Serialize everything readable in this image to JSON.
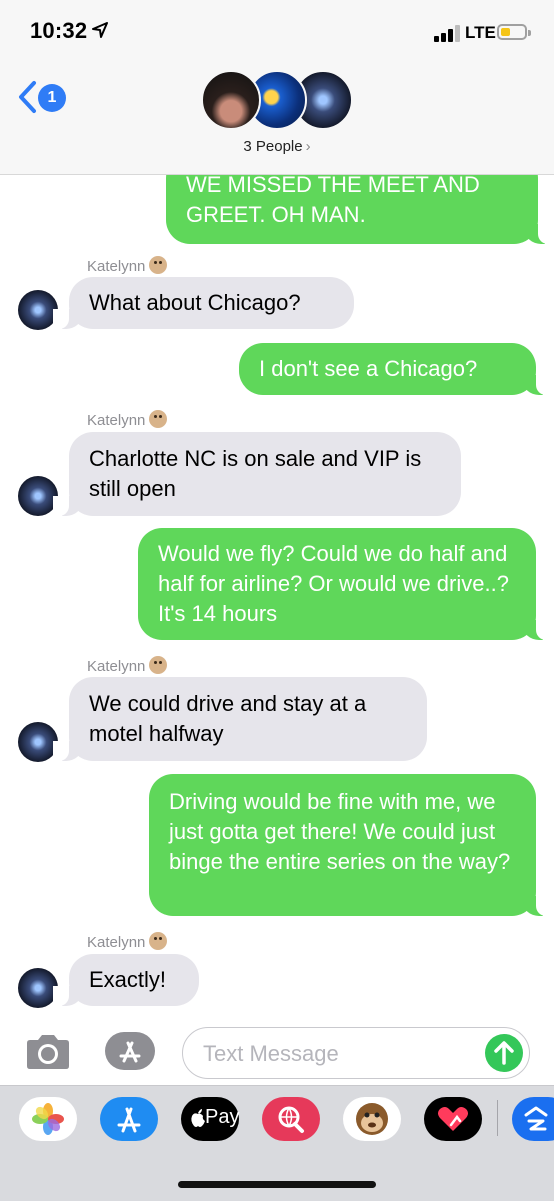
{
  "status_bar": {
    "time": "10:32",
    "network": "LTE"
  },
  "header": {
    "back_badge": "1",
    "subtitle": "3 People",
    "subtitle_chevron": "›"
  },
  "messages": [
    {
      "type": "out",
      "text": "WE MISSED THE MEET AND GREET. OH MAN."
    },
    {
      "type": "in",
      "sender": "Katelynn",
      "text": "What about Chicago?"
    },
    {
      "type": "out",
      "text": "I don't see a Chicago?"
    },
    {
      "type": "in",
      "sender": "Katelynn",
      "text": "Charlotte NC is on sale and VIP is still open"
    },
    {
      "type": "out",
      "text": "Would we fly? Could we do half and half for airline? Or would we drive..? It's 14 hours"
    },
    {
      "type": "in",
      "sender": "Katelynn",
      "text": "We could drive and stay at a motel halfway"
    },
    {
      "type": "out",
      "text": "Driving would be fine with me, we just gotta get there! We could just binge the entire series on the way?"
    },
    {
      "type": "in",
      "sender": "Katelynn",
      "text": "Exactly!"
    }
  ],
  "composer": {
    "placeholder": "Text Message"
  },
  "app_drawer": {
    "apps": [
      {
        "name": "photos-icon"
      },
      {
        "name": "app-store-icon"
      },
      {
        "name": "apple-pay-icon",
        "label": "Pay"
      },
      {
        "name": "web-search-icon"
      },
      {
        "name": "animoji-icon"
      },
      {
        "name": "digital-touch-icon"
      },
      {
        "name": "zillow-icon"
      }
    ]
  },
  "colors": {
    "outgoing_bubble": "#5fd75a",
    "incoming_bubble": "#e6e5eb",
    "accent": "#2f7cf6",
    "send_button": "#34c759"
  }
}
